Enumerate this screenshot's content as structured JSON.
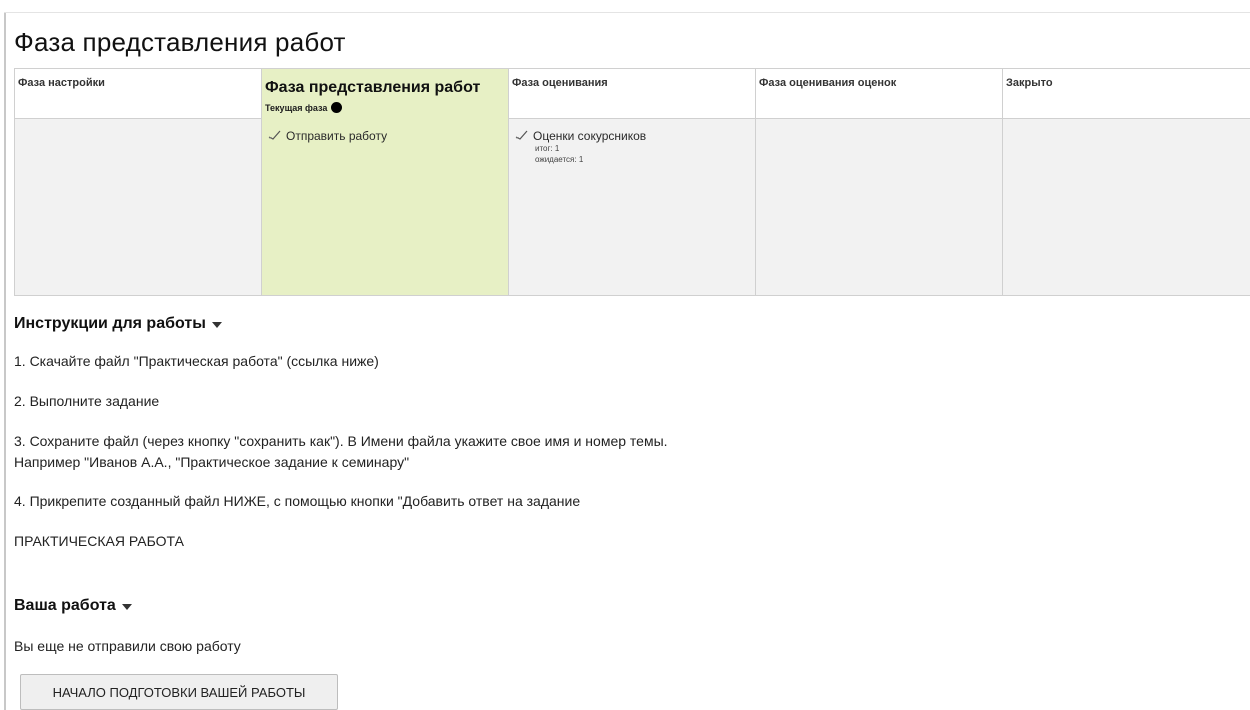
{
  "page": {
    "title": "Фаза представления работ"
  },
  "phases": [
    {
      "name": "Фаза настройки",
      "tasks": []
    },
    {
      "name": "Фаза представления работ",
      "current_label": "Текущая фаза",
      "tasks": [
        {
          "label": "Отправить работу"
        }
      ]
    },
    {
      "name": "Фаза оценивания",
      "tasks": [
        {
          "label": "Оценки сокурсников",
          "details": [
            "итог: 1",
            "ожидается: 1"
          ]
        }
      ]
    },
    {
      "name": "Фаза оценивания оценок",
      "tasks": []
    },
    {
      "name": "Закрыто",
      "tasks": []
    }
  ],
  "instructions": {
    "heading": "Инструкции для работы",
    "lines": [
      "1. Скачайте файл \"Практическая работа\" (ссылка ниже)",
      "2. Выполните задание",
      "3. Сохраните файл (через кнопку \"сохранить как\"). В Имени файла укажите свое имя и номер темы.",
      "Например \"Иванов А.А., \"Практическое задание к семинару\"",
      "4. Прикрепите созданный файл НИЖЕ, с помощью кнопки \"Добавить ответ на задание",
      "ПРАКТИЧЕСКАЯ РАБОТА"
    ]
  },
  "submission": {
    "heading": "Ваша работа",
    "status": "Вы еще не отправили свою работу",
    "button_label": "НАЧАЛО ПОДГОТОВКИ ВАШЕЙ РАБОТЫ"
  },
  "icons": {
    "task": "checkmark-icon",
    "current": "filled-circle-icon",
    "collapse": "caret-down-icon"
  }
}
